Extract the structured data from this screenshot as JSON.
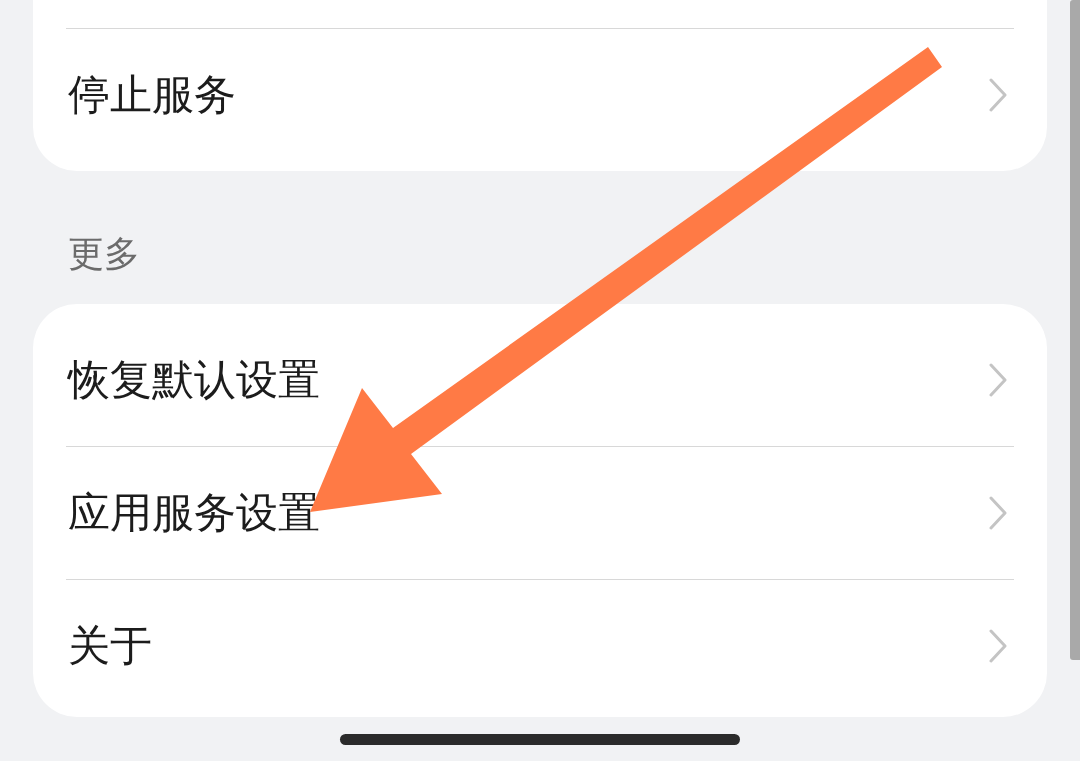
{
  "sections": [
    {
      "items": [
        {
          "label": "停止服务"
        }
      ]
    },
    {
      "header": "更多",
      "items": [
        {
          "label": "恢复默认设置"
        },
        {
          "label": "应用服务设置"
        },
        {
          "label": "关于"
        }
      ]
    }
  ]
}
